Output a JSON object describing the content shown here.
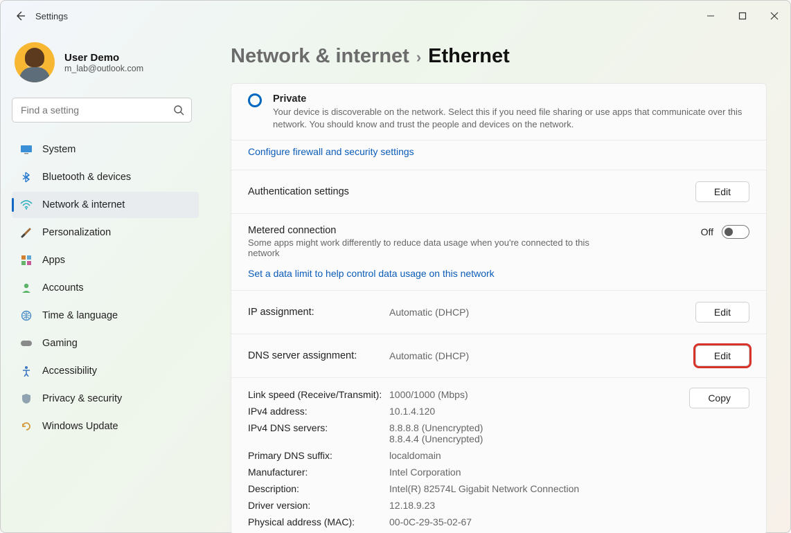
{
  "app_title": "Settings",
  "user": {
    "name": "User Demo",
    "email": "m_lab@outlook.com"
  },
  "search": {
    "placeholder": "Find a setting"
  },
  "sidebar": {
    "items": [
      {
        "label": "System"
      },
      {
        "label": "Bluetooth & devices"
      },
      {
        "label": "Network & internet"
      },
      {
        "label": "Personalization"
      },
      {
        "label": "Apps"
      },
      {
        "label": "Accounts"
      },
      {
        "label": "Time & language"
      },
      {
        "label": "Gaming"
      },
      {
        "label": "Accessibility"
      },
      {
        "label": "Privacy & security"
      },
      {
        "label": "Windows Update"
      }
    ]
  },
  "breadcrumb": {
    "part1": "Network & internet",
    "part2": "Ethernet"
  },
  "private_section": {
    "title": "Private",
    "desc": "Your device is discoverable on the network. Select this if you need file sharing or use apps that communicate over this network. You should know and trust the people and devices on the network.",
    "firewall_link": "Configure firewall and security settings"
  },
  "auth_row": {
    "label": "Authentication settings",
    "edit": "Edit"
  },
  "metered_row": {
    "label": "Metered connection",
    "desc": "Some apps might work differently to reduce data usage when you're connected to this network",
    "off_label": "Off",
    "limit_link": "Set a data limit to help control data usage on this network"
  },
  "ip_row": {
    "label": "IP assignment:",
    "value": "Automatic (DHCP)",
    "edit": "Edit"
  },
  "dns_row": {
    "label": "DNS server assignment:",
    "value": "Automatic (DHCP)",
    "edit": "Edit"
  },
  "details": {
    "copy": "Copy",
    "rows": [
      {
        "k": "Link speed (Receive/Transmit):",
        "v": "1000/1000 (Mbps)"
      },
      {
        "k": "IPv4 address:",
        "v": "10.1.4.120"
      },
      {
        "k": "IPv4 DNS servers:",
        "v": "8.8.8.8 (Unencrypted)\n8.8.4.4 (Unencrypted)"
      },
      {
        "k": "Primary DNS suffix:",
        "v": "localdomain"
      },
      {
        "k": "Manufacturer:",
        "v": "Intel Corporation"
      },
      {
        "k": "Description:",
        "v": "Intel(R) 82574L Gigabit Network Connection"
      },
      {
        "k": "Driver version:",
        "v": "12.18.9.23"
      },
      {
        "k": "Physical address (MAC):",
        "v": "00-0C-29-35-02-67"
      }
    ]
  }
}
